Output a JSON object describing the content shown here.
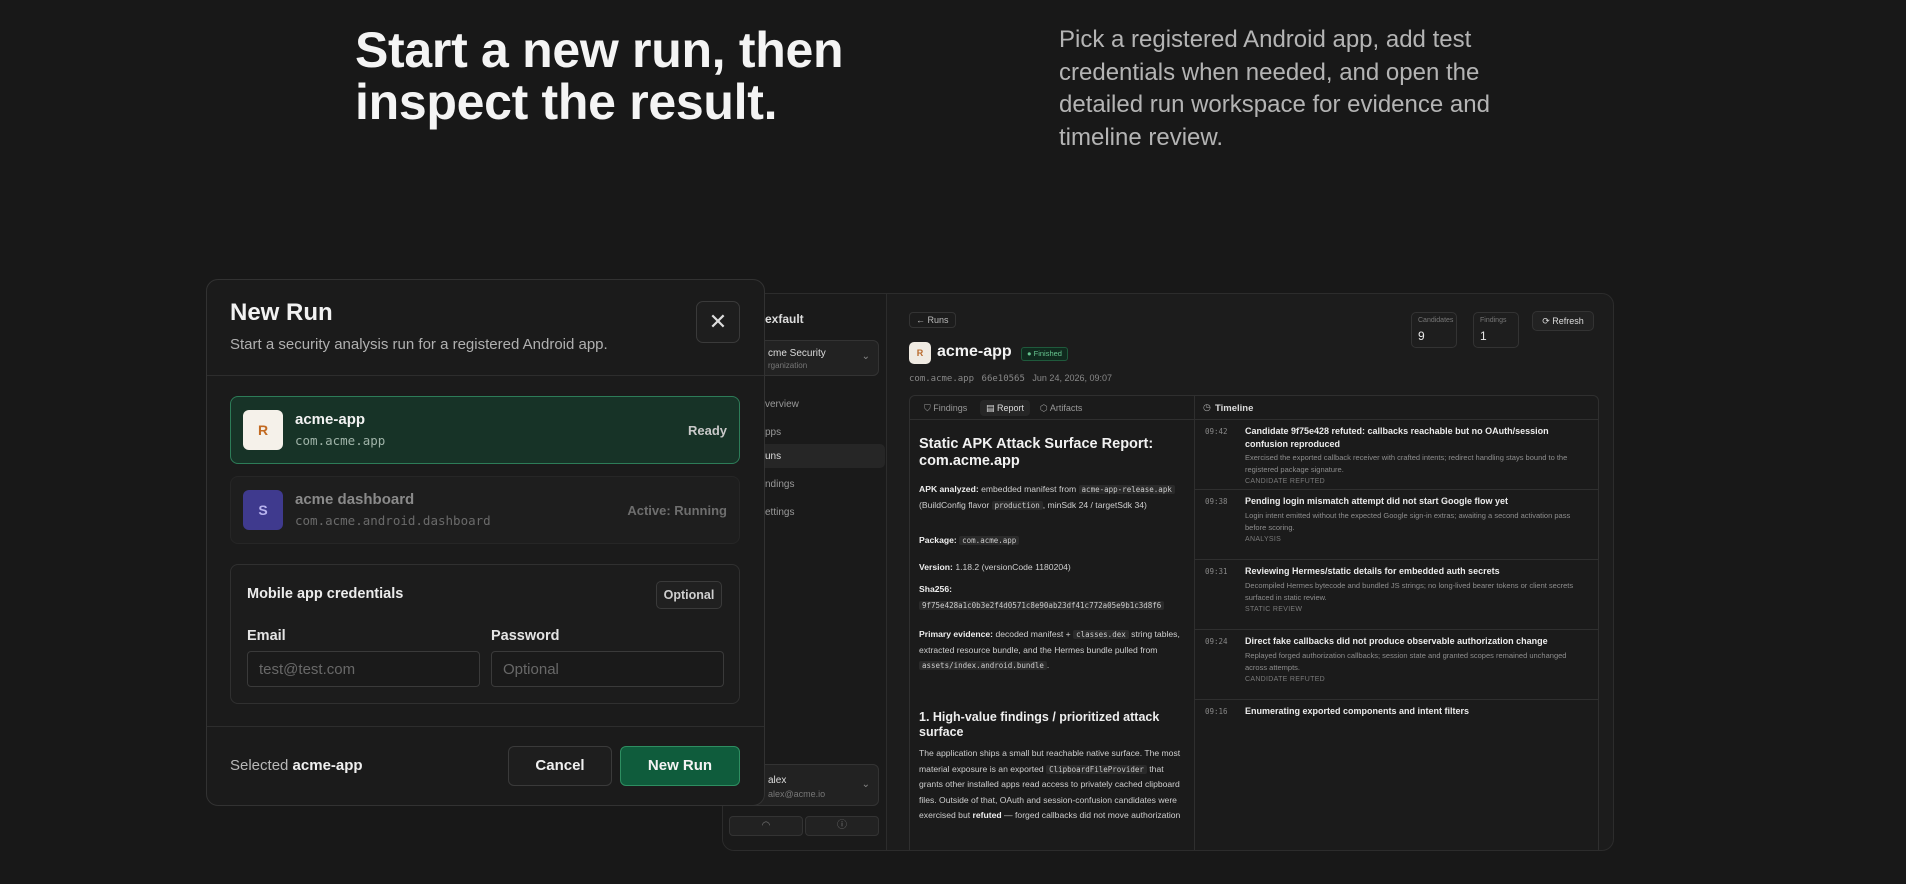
{
  "hero": {
    "title": "Start a new run, then inspect the result.",
    "description": "Pick a registered Android app, add test credentials when needed, and open the detailed run workspace for evidence and timeline review."
  },
  "background_app": {
    "sidebar": {
      "brand": "exfault",
      "org_name": "cme Security",
      "org_sub": "rganization",
      "nav": [
        "verview",
        "pps",
        "uns",
        "ndings",
        "ettings"
      ],
      "active_nav": "uns",
      "user_name": "alex",
      "user_email": "alex@acme.io"
    },
    "header": {
      "back_label": "Runs",
      "app_initial": "R",
      "app_name": "acme-app",
      "status_badge": "Finished",
      "package": "com.acme.app",
      "run_id": "66e10565",
      "date": "Jun 24, 2026, 09:07",
      "candidates_label": "Candidates",
      "candidates_value": "9",
      "findings_label": "Findings",
      "findings_value": "1",
      "refresh_label": "Refresh"
    },
    "tabs": [
      "Findings",
      "Report",
      "Artifacts"
    ],
    "active_tab": "Report",
    "report": {
      "title": "Static APK Attack Surface Report: com.acme.app",
      "apk_label": "APK analyzed:",
      "apk_text1": "embedded manifest from",
      "apk_code1": "acme-app-release.apk",
      "apk_text2": "(BuildConfig flavor",
      "apk_code2": "production",
      "apk_text3": ", minSdk 24 / targetSdk 34)",
      "package_label": "Package:",
      "package_code": "com.acme.app",
      "version_label": "Version:",
      "version_text": "1.18.2 (versionCode 1180204)",
      "sha_label": "Sha256:",
      "sha_code": "9f75e428a1c0b3e2f4d0571c8e90ab23df41c772a05e9b1c3d8f6",
      "evidence_label": "Primary evidence:",
      "evidence_text1": "decoded manifest +",
      "evidence_code1": "classes.dex",
      "evidence_text2": "string tables, extracted resource bundle, and the Hermes bundle pulled from",
      "evidence_code2": "assets/index.android.bundle",
      "evidence_text3": ".",
      "section_title": "1. High-value findings / prioritized attack surface",
      "section_text1": "The application ships a small but reachable native surface. The most material exposure is an exported",
      "section_code": "ClipboardFileProvider",
      "section_text2": "that grants other installed apps read access to privately cached clipboard files. Outside of that, OAuth and session-confusion candidates were exercised but",
      "section_bold": "refuted",
      "section_text3": "— forged callbacks did not move authorization"
    },
    "timeline": {
      "title": "Timeline",
      "items": [
        {
          "time": "09:42",
          "title": "Candidate 9f75e428 refuted: callbacks reachable but no OAuth/session confusion reproduced",
          "desc": "Exercised the exported callback receiver with crafted intents; redirect handling stays bound to the registered package signature.",
          "tag": "CANDIDATE REFUTED"
        },
        {
          "time": "09:38",
          "title": "Pending login mismatch attempt did not start Google flow yet",
          "desc": "Login intent emitted without the expected Google sign-in extras; awaiting a second activation pass before scoring.",
          "tag": "ANALYSIS"
        },
        {
          "time": "09:31",
          "title": "Reviewing Hermes/static details for embedded auth secrets",
          "desc": "Decompiled Hermes bytecode and bundled JS strings; no long-lived bearer tokens or client secrets surfaced in static review.",
          "tag": "STATIC REVIEW"
        },
        {
          "time": "09:24",
          "title": "Direct fake callbacks did not produce observable authorization change",
          "desc": "Replayed forged authorization callbacks; session state and granted scopes remained unchanged across attempts.",
          "tag": "CANDIDATE REFUTED"
        },
        {
          "time": "09:16",
          "title": "Enumerating exported components and intent filters",
          "desc": "",
          "tag": ""
        }
      ]
    }
  },
  "modal": {
    "title": "New Run",
    "subtitle": "Start a security analysis run for a registered Android app.",
    "apps": [
      {
        "initial": "R",
        "name": "acme-app",
        "package": "com.acme.app",
        "status": "Ready",
        "avatar_bg": "#f5f1ea",
        "avatar_fg": "#c26a22",
        "status_color": "#c9c9c9"
      },
      {
        "initial": "S",
        "name": "acme dashboard",
        "package": "com.acme.android.dashboard",
        "status": "Active: Running",
        "avatar_bg": "#3f3a8e",
        "avatar_fg": "#b9b4ef",
        "status_color": "#6e6e6e"
      }
    ],
    "credentials": {
      "title": "Mobile app credentials",
      "optional_badge": "Optional",
      "email_label": "Email",
      "email_placeholder": "test@test.com",
      "password_label": "Password",
      "password_placeholder": "Optional"
    },
    "footer": {
      "selected_prefix": "Selected",
      "selected_app": "acme-app",
      "cancel_label": "Cancel",
      "submit_label": "New Run"
    }
  },
  "colors": {
    "accent": "#0f5c3c",
    "accent_border": "#2d7c58",
    "background": "#181818"
  }
}
